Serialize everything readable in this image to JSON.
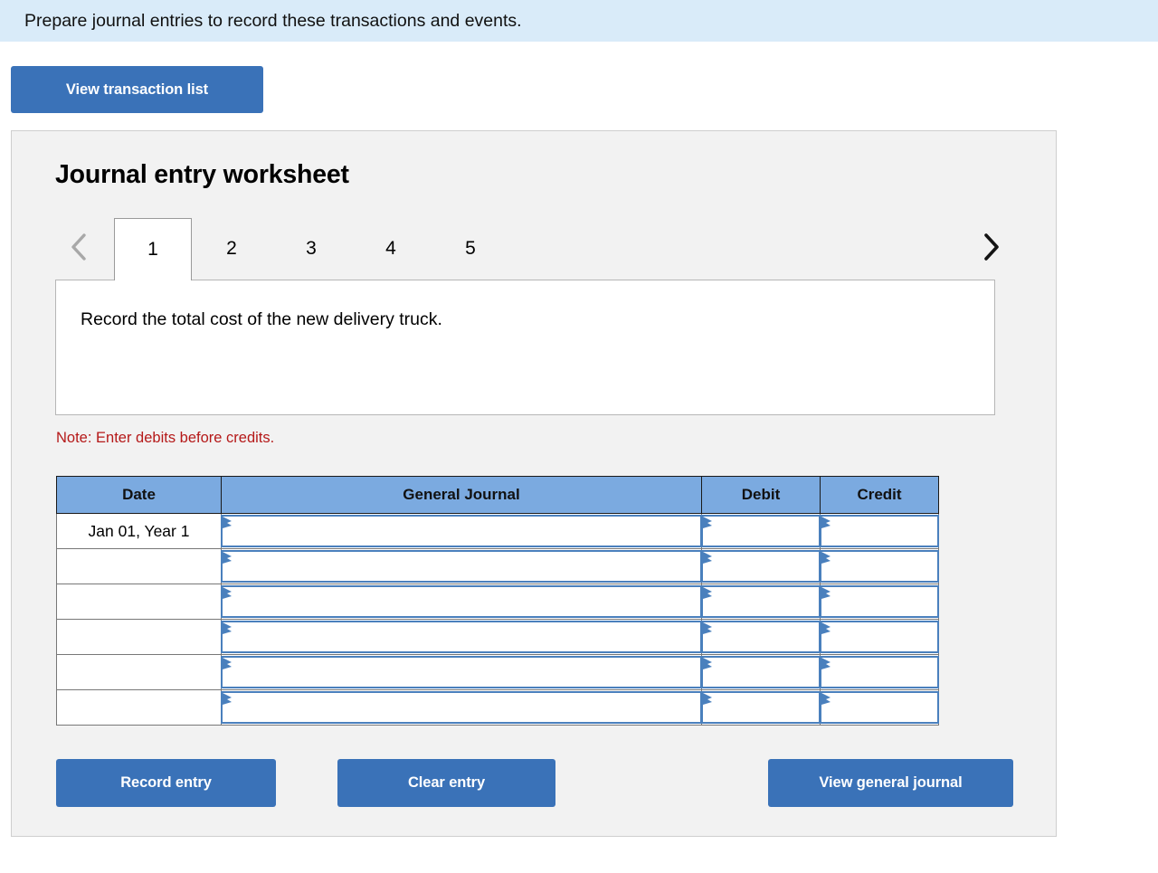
{
  "instruction": {
    "text": "Prepare journal entries to record these transactions and events.",
    "background_color": "#d9ebf9"
  },
  "toolbar": {
    "view_transaction_list_label": "View transaction list"
  },
  "worksheet": {
    "title": "Journal entry worksheet",
    "prev_icon": "chevron-left-icon",
    "next_icon": "chevron-right-icon",
    "tabs": [
      {
        "label": "1",
        "active": true
      },
      {
        "label": "2",
        "active": false
      },
      {
        "label": "3",
        "active": false
      },
      {
        "label": "4",
        "active": false
      },
      {
        "label": "5",
        "active": false
      }
    ],
    "description": "Record the total cost of the new delivery truck.",
    "note": "Note: Enter debits before credits.",
    "note_color": "#b51919"
  },
  "table": {
    "headers": [
      "Date",
      "General Journal",
      "Debit",
      "Credit"
    ],
    "header_color": "#7baae0",
    "input_border_color": "#4a80bd",
    "rows": [
      {
        "date": "Jan 01, Year 1",
        "general_journal": "",
        "debit": "",
        "credit": ""
      },
      {
        "date": "",
        "general_journal": "",
        "debit": "",
        "credit": ""
      },
      {
        "date": "",
        "general_journal": "",
        "debit": "",
        "credit": ""
      },
      {
        "date": "",
        "general_journal": "",
        "debit": "",
        "credit": ""
      },
      {
        "date": "",
        "general_journal": "",
        "debit": "",
        "credit": ""
      },
      {
        "date": "",
        "general_journal": "",
        "debit": "",
        "credit": ""
      }
    ]
  },
  "actions": {
    "record_entry_label": "Record entry",
    "clear_entry_label": "Clear entry",
    "view_general_journal_label": "View general journal",
    "button_color": "#3a72b8"
  }
}
